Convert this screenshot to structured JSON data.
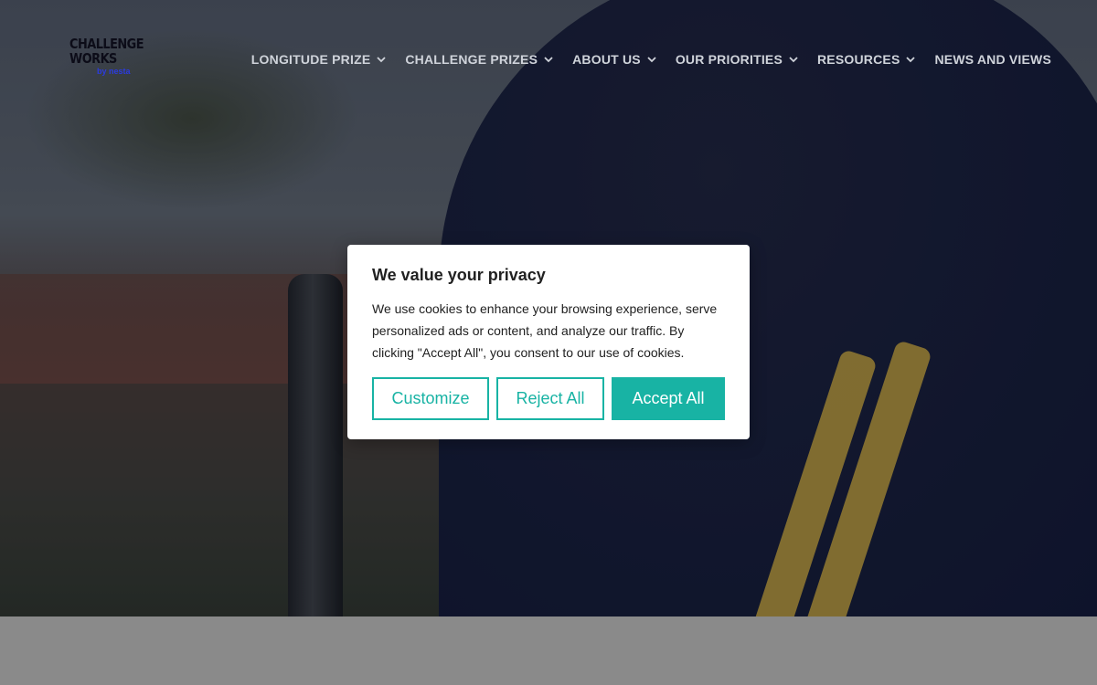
{
  "site": {
    "logo": {
      "line1": "CHALLENGE",
      "line2": "WORKS",
      "line3": "by nesta"
    }
  },
  "nav": {
    "items": [
      {
        "label": "LONGITUDE PRIZE",
        "has_dropdown": true
      },
      {
        "label": "CHALLENGE PRIZES",
        "has_dropdown": true
      },
      {
        "label": "ABOUT US",
        "has_dropdown": true
      },
      {
        "label": "OUR PRIORITIES",
        "has_dropdown": true
      },
      {
        "label": "RESOURCES",
        "has_dropdown": true
      },
      {
        "label": "NEWS AND VIEWS",
        "has_dropdown": false
      }
    ],
    "dropdown_icon": "chevron-down-icon"
  },
  "cookie_banner": {
    "title": "We value your privacy",
    "text": "We use cookies to enhance your browsing experience, serve personalized ads or content, and analyze our traffic. By clicking \"Accept All\", you consent to our use of cookies.",
    "buttons": {
      "customize": "Customize",
      "reject": "Reject All",
      "accept": "Accept All"
    }
  },
  "colors": {
    "accent": "#18b3a4",
    "nav_text": "#cfd3da",
    "logo_accent": "#2b3be0"
  }
}
